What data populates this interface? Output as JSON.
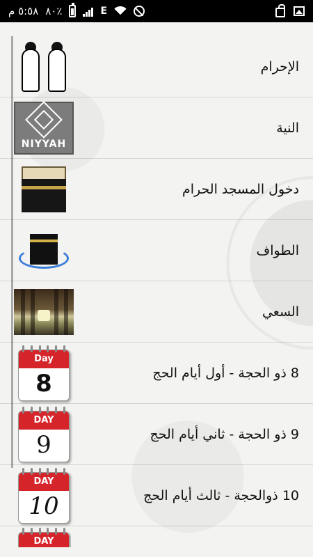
{
  "statusbar": {
    "time": "٥:٥٨ م",
    "battery": "٨٠٪",
    "network": "E"
  },
  "menu": {
    "items": [
      {
        "label": "الإحرام",
        "icon": "ihram-pilgrims-icon"
      },
      {
        "label": "النية",
        "icon": "niyyah-emblem-icon",
        "badge_text": "NIYYAH"
      },
      {
        "label": "دخول المسجد الحرام",
        "icon": "kaaba-icon"
      },
      {
        "label": "الطواف",
        "icon": "tawaf-icon"
      },
      {
        "label": "السعي",
        "icon": "sai-corridor-icon"
      },
      {
        "label": "8 ذو الحجة - أول أيام الحج",
        "icon": "calendar-day-8-icon",
        "cal_header": "Day",
        "cal_number": "8"
      },
      {
        "label": "9 ذو الحجة - ثاني أيام الحج",
        "icon": "calendar-day-9-icon",
        "cal_header": "DAY",
        "cal_number": "9"
      },
      {
        "label": "10 ذوالحجة - ثالث أيام الحج",
        "icon": "calendar-day-10-icon",
        "cal_header": "DAY",
        "cal_number": "10"
      },
      {
        "label": "",
        "icon": "calendar-day-11-icon",
        "cal_header": "DAY"
      }
    ]
  }
}
